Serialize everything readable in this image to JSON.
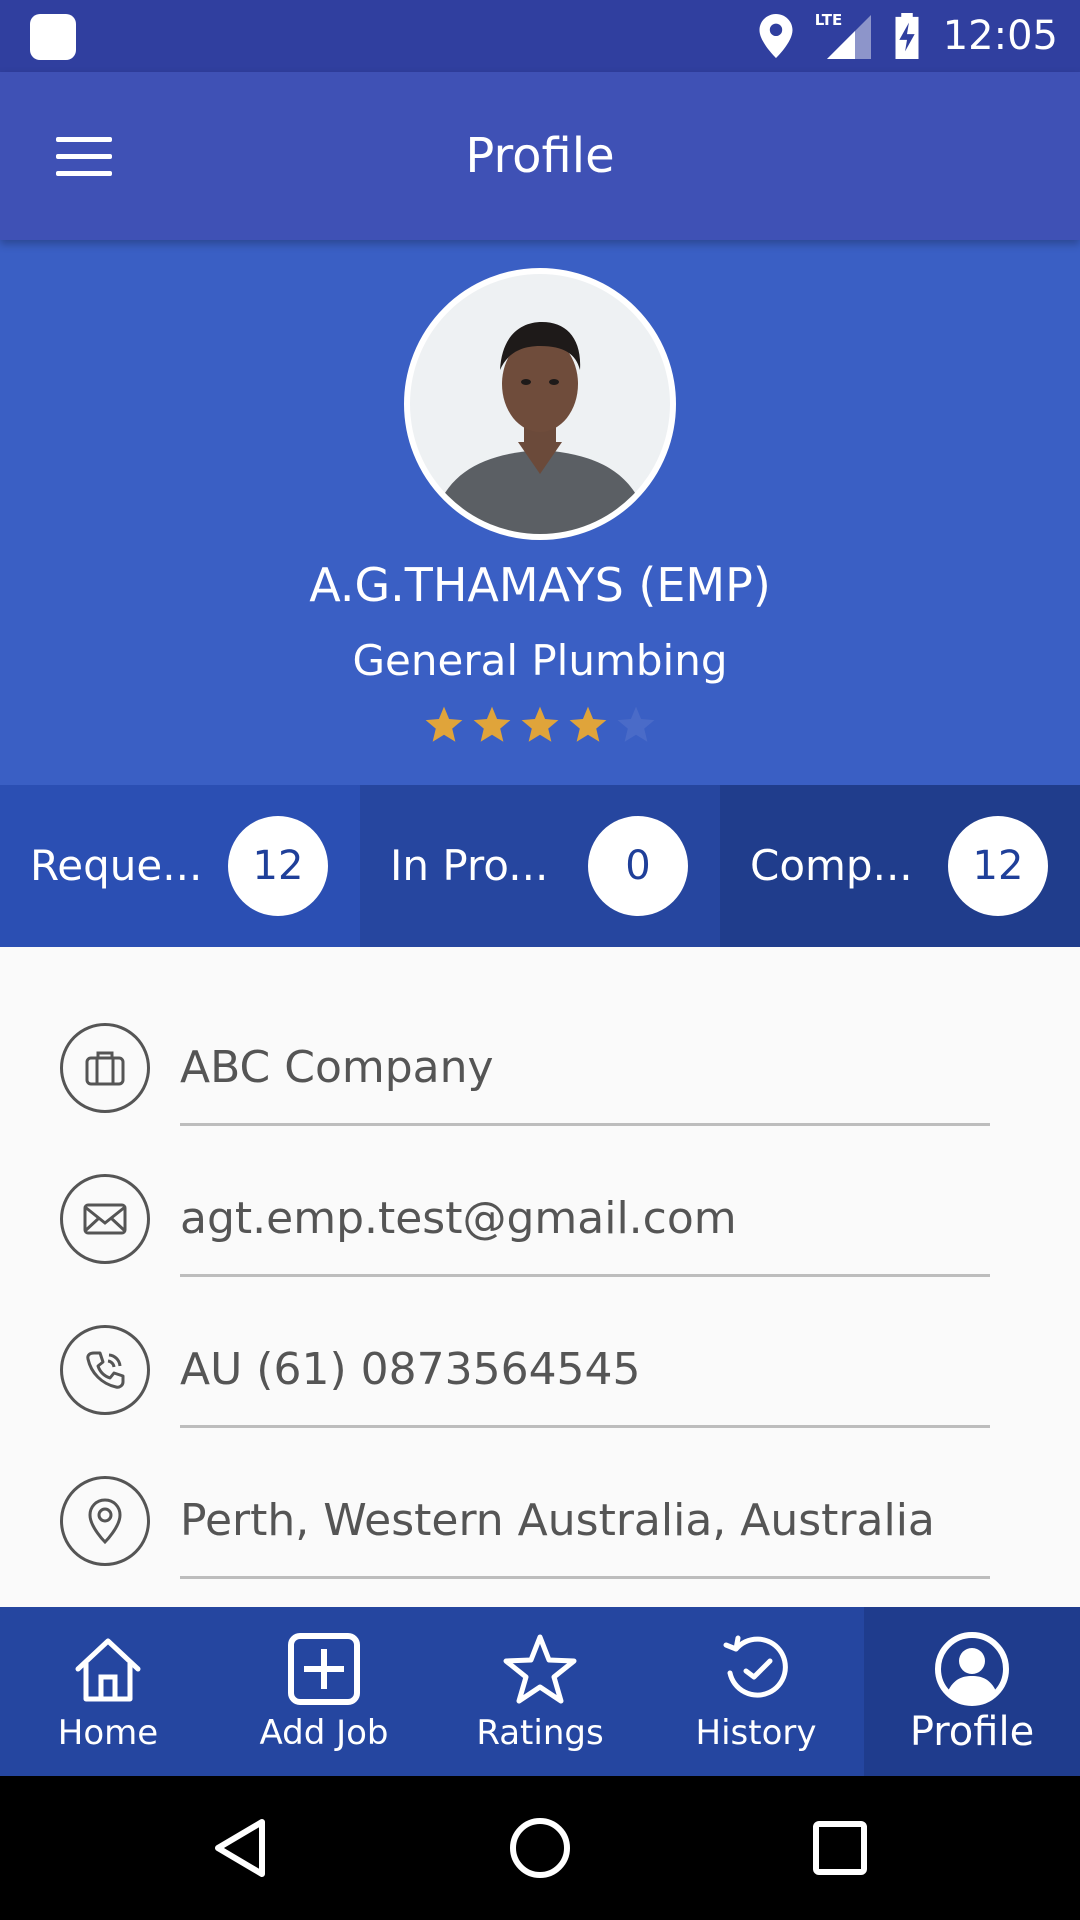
{
  "status_bar": {
    "time": "12:05",
    "network_label": "LTE"
  },
  "app_bar": {
    "title": "Profile"
  },
  "profile": {
    "name": "A.G.THAMAYS (EMP)",
    "role": "General Plumbing",
    "rating": 4,
    "rating_max": 5,
    "star_color": "#e0a43a",
    "star_empty_color": "#4a6bc8"
  },
  "stats": [
    {
      "label": "Reque...",
      "count": "12",
      "bg": "#2b4fb3"
    },
    {
      "label": "In  Pro...",
      "count": "0",
      "bg": "#26469f"
    },
    {
      "label": "Comp...",
      "count": "12",
      "bg": "#203d8c"
    }
  ],
  "info": {
    "company": "ABC Company",
    "email": "agt.emp.test@gmail.com",
    "phone": "AU (61) 0873564545",
    "location": "Perth, Western Australia, Australia"
  },
  "bottom_nav": [
    {
      "label": "Home",
      "icon": "home-icon"
    },
    {
      "label": "Add Job",
      "icon": "add-box-icon"
    },
    {
      "label": "Ratings",
      "icon": "star-outline-icon"
    },
    {
      "label": "History",
      "icon": "history-icon"
    },
    {
      "label": "Profile",
      "icon": "account-circle-icon",
      "active": true
    }
  ],
  "colors": {
    "status_bar": "#303f9f",
    "app_bar": "#3f51b5",
    "header": "#3a5fc4",
    "bottom_nav": "#2546a0"
  }
}
